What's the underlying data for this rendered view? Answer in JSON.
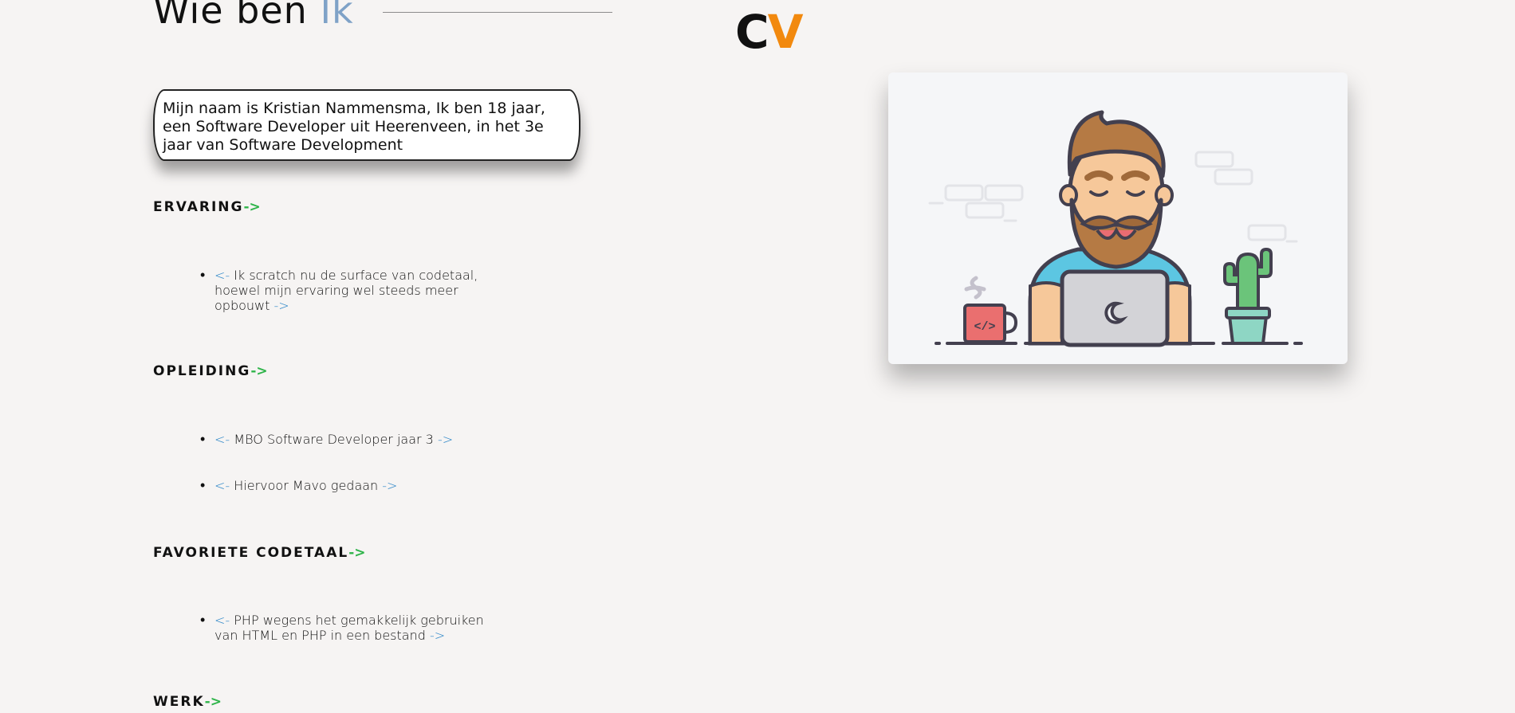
{
  "header": {
    "title_main": "Wie ben ",
    "title_accent": "Ik"
  },
  "logo": {
    "c": "C",
    "v": "V"
  },
  "intro": "Mijn naam is Kristian Nammensma, Ik ben 18 jaar, een Software Developer uit Heerenveen, in het 3e jaar van Software Development",
  "sections": {
    "ervaring": {
      "title": "ERVARING",
      "arrow": "->",
      "items": [
        {
          "open": "<-",
          "text": " Ik scratch nu de surface van codetaal, hoewel mijn ervaring wel steeds meer opbouwt ",
          "close": "->"
        }
      ]
    },
    "opleiding": {
      "title": "OPLEIDING",
      "arrow": "->",
      "items": [
        {
          "open": "<-",
          "text": " MBO Software Developer jaar 3 ",
          "close": "->"
        },
        {
          "open": "<-",
          "text": " Hiervoor Mavo gedaan ",
          "close": "->"
        }
      ]
    },
    "codetaal": {
      "title": "FAVORIETE CODETAAL",
      "arrow": "->",
      "items": [
        {
          "open": "<-",
          "text": " PHP wegens het gemakkelijk gebruiken van HTML en PHP in een bestand ",
          "close": "->"
        }
      ]
    },
    "werk": {
      "title": "WERK",
      "arrow": "->"
    }
  },
  "bullet": "•",
  "illustration": {
    "icon": "developer-at-laptop-illustration",
    "mug_label": "</>"
  },
  "colors": {
    "background": "#f6f4f3",
    "accent_blue": "#7fa2c7",
    "logo_orange": "#f2890e",
    "arrow_green": "#2fb44a",
    "arrow_blue": "#2f87c8"
  }
}
